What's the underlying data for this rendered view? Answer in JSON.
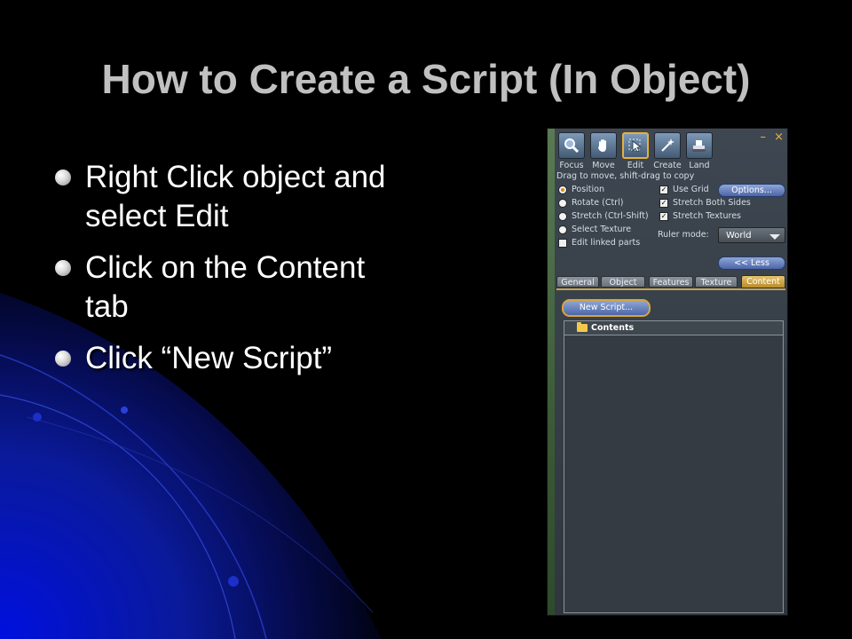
{
  "slide": {
    "title": "How to Create a Script (In Object)",
    "bullets": [
      "Right Click object and select Edit",
      "Click on the Content tab",
      "Click “New Script”"
    ]
  },
  "editor": {
    "window_controls": {
      "minimize": "–",
      "close": "×"
    },
    "tools": [
      {
        "label": "Focus",
        "icon": "magnifier-icon"
      },
      {
        "label": "Move",
        "icon": "hand-icon"
      },
      {
        "label": "Edit",
        "icon": "pointer-icon",
        "active": true
      },
      {
        "label": "Create",
        "icon": "magic-wand-icon"
      },
      {
        "label": "Land",
        "icon": "bulldozer-icon"
      }
    ],
    "hint": "Drag to move, shift-drag to copy",
    "modes": [
      {
        "label": "Position",
        "selected": true
      },
      {
        "label": "Rotate (Ctrl)",
        "selected": false
      },
      {
        "label": "Stretch (Ctrl-Shift)",
        "selected": false
      },
      {
        "label": "Select Texture",
        "selected": false
      }
    ],
    "edit_linked_parts": {
      "label": "Edit linked parts",
      "checked": false
    },
    "use_grid": {
      "label": "Use Grid",
      "checked": true
    },
    "options_button": "Options...",
    "stretch_both_sides": {
      "label": "Stretch Both Sides",
      "checked": true
    },
    "stretch_textures": {
      "label": "Stretch Textures",
      "checked": true
    },
    "ruler_mode": {
      "label": "Ruler mode:",
      "value": "World"
    },
    "less_button": "<< Less",
    "tabs": [
      {
        "label": "General",
        "active": false
      },
      {
        "label": "Object",
        "active": false
      },
      {
        "label": "Features",
        "active": false
      },
      {
        "label": "Texture",
        "active": false
      },
      {
        "label": "Content",
        "active": true
      }
    ],
    "new_script_button": "New Script...",
    "contents_root": "Contents"
  },
  "colors": {
    "title": "#c0c0c0",
    "accent_gold": "#d9a53a",
    "button_blue": "#4d66a8"
  }
}
